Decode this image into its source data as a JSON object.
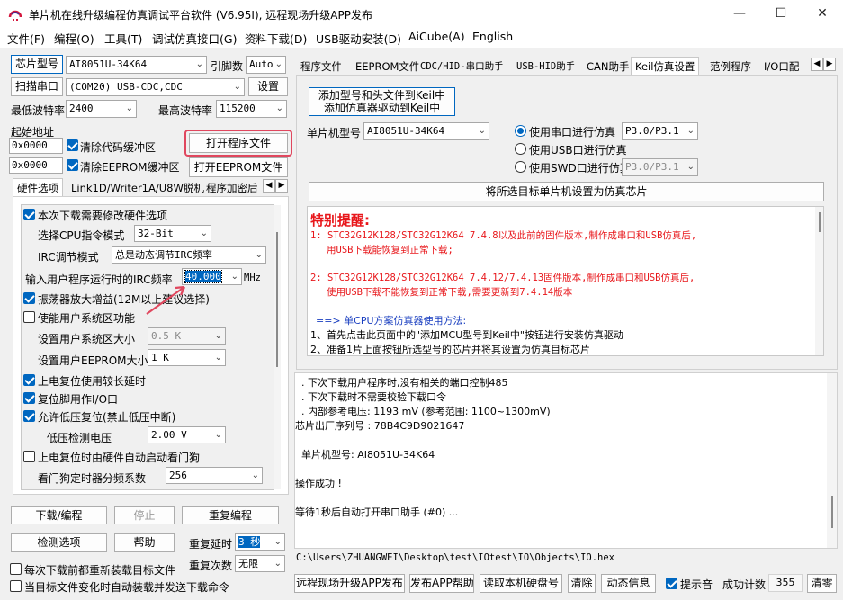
{
  "window": {
    "title": "单片机在线升级编程仿真调试平台软件 (V6.95I), 远程现场升级APP发布",
    "minimize": "—",
    "maximize": "☐",
    "close": "✕"
  },
  "menu": [
    "文件(F)",
    "编程(O)",
    "工具(T)",
    "调试仿真接口(G)",
    "资料下载(D)",
    "USB驱动安装(D)",
    "AiCube(A)",
    "English"
  ],
  "left": {
    "chip_button": "芯片型号",
    "chip_value": "AI8051U-34K64",
    "pins_label": "引脚数",
    "pins_value": "Auto",
    "scan_button": "扫描串口",
    "port_value": "(COM20) USB-CDC,CDC",
    "settings_button": "设置",
    "min_baud_label": "最低波特率",
    "min_baud_value": "2400",
    "max_baud_label": "最高波特率",
    "max_baud_value": "115200",
    "start_addr_label": "起始地址",
    "addr1": "0x0000",
    "clear_code": "清除代码缓冲区",
    "open_program": "打开程序文件",
    "addr2": "0x0000",
    "clear_eeprom": "清除EEPROM缓冲区",
    "open_eeprom": "打开EEPROM文件",
    "tabs": [
      "硬件选项",
      "Link1D/Writer1A/U8W脱机",
      "程序加密后"
    ],
    "hw": {
      "modify_hw": "本次下载需要修改硬件选项",
      "cpu_mode_label": "选择CPU指令模式",
      "cpu_mode_value": "32-Bit",
      "irc_mode_label": "IRC调节模式",
      "irc_mode_value": "总是动态调节IRC频率",
      "irc_freq_label": "输入用户程序运行时的IRC频率",
      "irc_freq_value": "40.000",
      "irc_freq_unit": "MHz",
      "osc_gain": "振荡器放大增益(12M以上建议选择)",
      "user_sys": "使能用户系统区功能",
      "user_sys_size_label": "设置用户系统区大小",
      "user_sys_size_value": "0.5 K",
      "eeprom_size_label": "设置用户EEPROM大小",
      "eeprom_size_value": "1   K",
      "power_delay": "上电复位使用较长延时",
      "reset_io": "复位脚用作I/O口",
      "lvr": "允许低压复位(禁止低压中断)",
      "lvd_label": "低压检测电压",
      "lvd_value": "2.00 V",
      "wdt": "上电复位时由硬件自动启动看门狗",
      "wdt_div_label": "看门狗定时器分频系数",
      "wdt_div_value": "256"
    },
    "download_button": "下载/编程",
    "stop_button": "停止",
    "repeat_button": "重复编程",
    "check_button": "检测选项",
    "help_button": "帮助",
    "repeat_delay_label": "重复延时",
    "repeat_delay_value": "3 秒",
    "repeat_count_label": "重复次数",
    "repeat_count_value": "无限",
    "reload_each": "每次下载前都重新装载目标文件",
    "auto_send": "当目标文件变化时自动装载并发送下载命令"
  },
  "right": {
    "tabs": [
      "程序文件",
      "EEPROM文件",
      "CDC/HID-串口助手",
      "USB-HID助手",
      "CAN助手",
      "Keil仿真设置",
      "范例程序",
      "I/O口配"
    ],
    "keil": {
      "add_button_line1": "添加型号和头文件到Keil中",
      "add_button_line2": "添加仿真器驱动到Keil中",
      "mcu_label": "单片机型号",
      "mcu_value": "AI8051U-34K64",
      "opt_serial": "使用串口进行仿真",
      "serial_port": "P3.0/P3.1",
      "opt_usb": "使用USB口进行仿真",
      "opt_swd": "使用SWD口进行仿真",
      "swd_port": "P3.0/P3.1",
      "set_button": "将所选目标单片机设置为仿真芯片"
    },
    "notice": {
      "title": "特别提醒:",
      "line1a": "1: STC32G12K128/STC32G12K64  7.4.8以及此前的固件版本,制作成串口和USB仿真后,",
      "line1b": "用USB下载能恢复到正常下载;",
      "line2a": "2: STC32G12K128/STC32G12K64  7.4.12/7.4.13固件版本,制作成串口和USB仿真后,",
      "line2b": "使用USB下载不能恢复到正常下载,需要更新到7.4.14版本",
      "usage": "==> 单CPU方案仿真器使用方法:",
      "step1": "1、首先点击此页面中的\"添加MCU型号到Keil中\"按钮进行安装仿真驱动",
      "step2": "2、准备1片上面按钮所选型号的芯片并将其设置为仿真目标芯片"
    },
    "log": [
      "  . 下次下载用户程序时,没有相关的端口控制485",
      "  . 下次下载时不需要校验下载口令",
      "  . 内部参考电压: 1193 mV (参考范围: 1100~1300mV)",
      "芯片出厂序列号 : 78B4C9D9021647",
      "",
      "  单片机型号: AI8051U-34K64",
      "",
      "操作成功 !",
      "",
      "等待1秒后自动打开串口助手 (#0) ..."
    ],
    "path": "C:\\Users\\ZHUANGWEI\\Desktop\\test\\IOtest\\IO\\Objects\\IO.hex"
  },
  "bottom": {
    "remote_app": "远程现场升级APP发布",
    "publish_help": "发布APP帮助",
    "read_disk": "读取本机硬盘号",
    "clear": "清除",
    "dynamic_info": "动态信息",
    "beep": "提示音",
    "success_label": "成功计数",
    "success_count": "355",
    "clear2": "清零"
  },
  "colors": {
    "accent": "#0067c0",
    "highlight": "#e0475e",
    "notice_red": "#e8171b"
  }
}
